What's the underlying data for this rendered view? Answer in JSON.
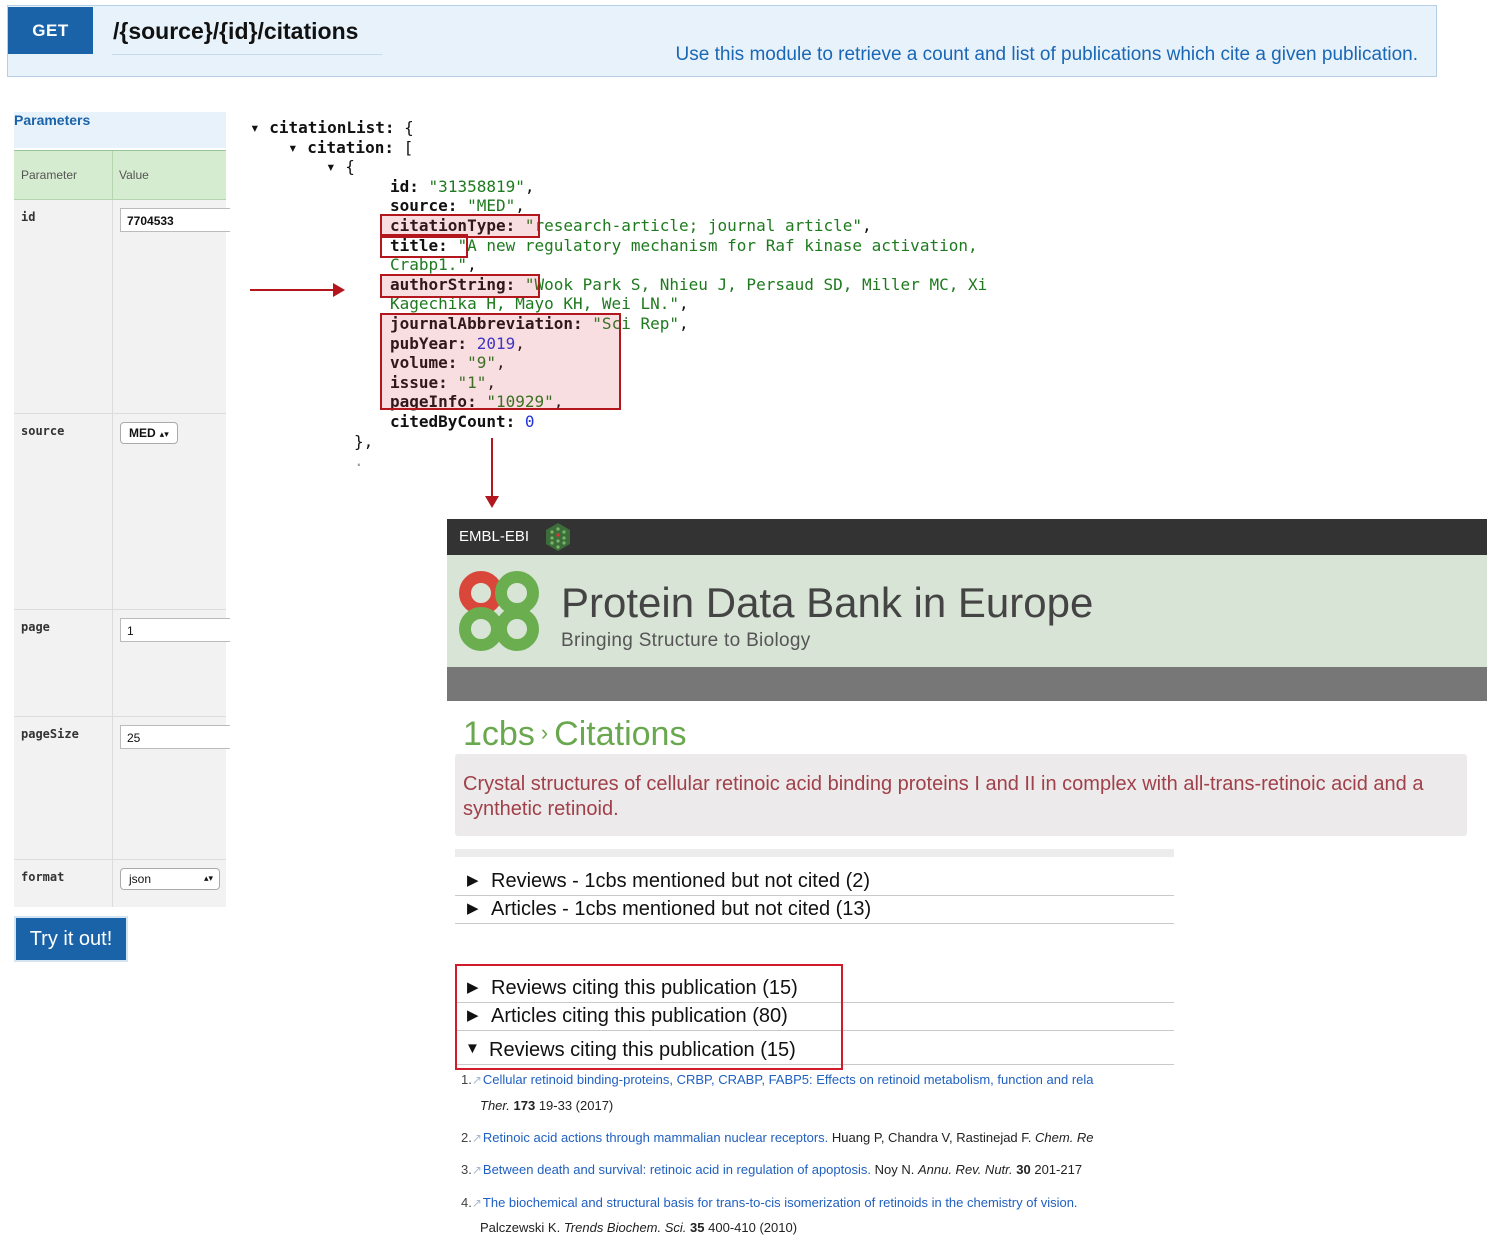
{
  "api": {
    "method": "GET",
    "path": "/{source}/{id}/citations",
    "description": "Use this module to retrieve a count and list of publications which cite a given publication."
  },
  "params": {
    "title": "Parameters",
    "col_parameter": "Parameter",
    "col_value": "Value",
    "rows": [
      {
        "name": "id",
        "value": "7704533"
      },
      {
        "name": "source",
        "value": "MED"
      },
      {
        "name": "page",
        "value": "1"
      },
      {
        "name": "pageSize",
        "value": "25"
      },
      {
        "name": "format",
        "value": "json"
      }
    ],
    "try_label": "Try it out!"
  },
  "json_view": {
    "citationList": "citationList:",
    "citation": "citation:",
    "id_key": "id:",
    "id_val": "\"31358819\"",
    "source_key": "source:",
    "source_val": "\"MED\"",
    "citationType_key": "citationType:",
    "citationType_val": "\"research-article; journal article\"",
    "title_key": "title:",
    "title_val": "\"A new regulatory mechanism for Raf kinase activation,",
    "title_val2": "Crabp1.\"",
    "authorString_key": "authorString:",
    "authorString_val": "\"Wook Park S, Nhieu J, Persaud SD, Miller MC, Xi",
    "authorString_val2": "Kagechika H, Mayo KH, Wei LN.\"",
    "journalAbbreviation_key": "journalAbbreviation:",
    "journalAbbreviation_val": "\"Sci Rep\"",
    "pubYear_key": "pubYear:",
    "pubYear_val": "2019",
    "volume_key": "volume:",
    "volume_val": "\"9\"",
    "issue_key": "issue:",
    "issue_val": "\"1\"",
    "pageInfo_key": "pageInfo:",
    "pageInfo_val": "\"10929\"",
    "citedByCount_key": "citedByCount:",
    "citedByCount_val": "0"
  },
  "pdbe": {
    "ebi_label": "EMBL-EBI",
    "title": "Protein Data Bank in Europe",
    "subtitle": "Bringing Structure to Biology",
    "entry": "1cbs",
    "crumb_sep": "›",
    "page": "Citations",
    "publication_title": "Crystal structures of cellular retinoic acid binding proteins I and II in complex with all-trans-retinoic acid and a synthetic retinoid.",
    "sections": [
      {
        "label": "Reviews - 1cbs mentioned but not cited (2)",
        "open": false
      },
      {
        "label": "Articles - 1cbs mentioned but not cited (13)",
        "open": false
      },
      {
        "label": "Reviews citing this publication (15)",
        "open": false
      },
      {
        "label": "Articles citing this publication (80)",
        "open": false
      },
      {
        "label": "Reviews citing this publication (15)",
        "open": true
      }
    ],
    "citations": [
      {
        "num": "1.",
        "title": "Cellular retinoid binding-proteins, CRBP, CRABP, FABP5: Effects on retinoid metabolism, function and rela",
        "line2_journal": "Ther.",
        "line2_vol": "173",
        "line2_rest": "19-33 (2017)"
      },
      {
        "num": "2.",
        "title": "Retinoic acid actions through mammalian nuclear receptors.",
        "authors": "Huang P, Chandra V, Rastinejad F.",
        "journal": "Chem. Re"
      },
      {
        "num": "3.",
        "title": "Between death and survival: retinoic acid in regulation of apoptosis.",
        "authors": "Noy N.",
        "journal": "Annu. Rev. Nutr.",
        "vol": "30",
        "rest": "201-217"
      },
      {
        "num": "4.",
        "title": "The biochemical and structural basis for trans-to-cis isomerization of retinoids in the chemistry of vision.",
        "line2_authors": "Palczewski K.",
        "line2_journal": "Trends Biochem. Sci.",
        "line2_vol": "35",
        "line2_rest": "400-410 (2010)"
      }
    ]
  },
  "colors": {
    "api_blue": "#1b63a8",
    "highlight_red": "#b3161d",
    "json_string": "#1e7a1e",
    "json_number": "#2233dd",
    "pdbe_green": "#6aa84f",
    "link_blue": "#2060c0"
  }
}
